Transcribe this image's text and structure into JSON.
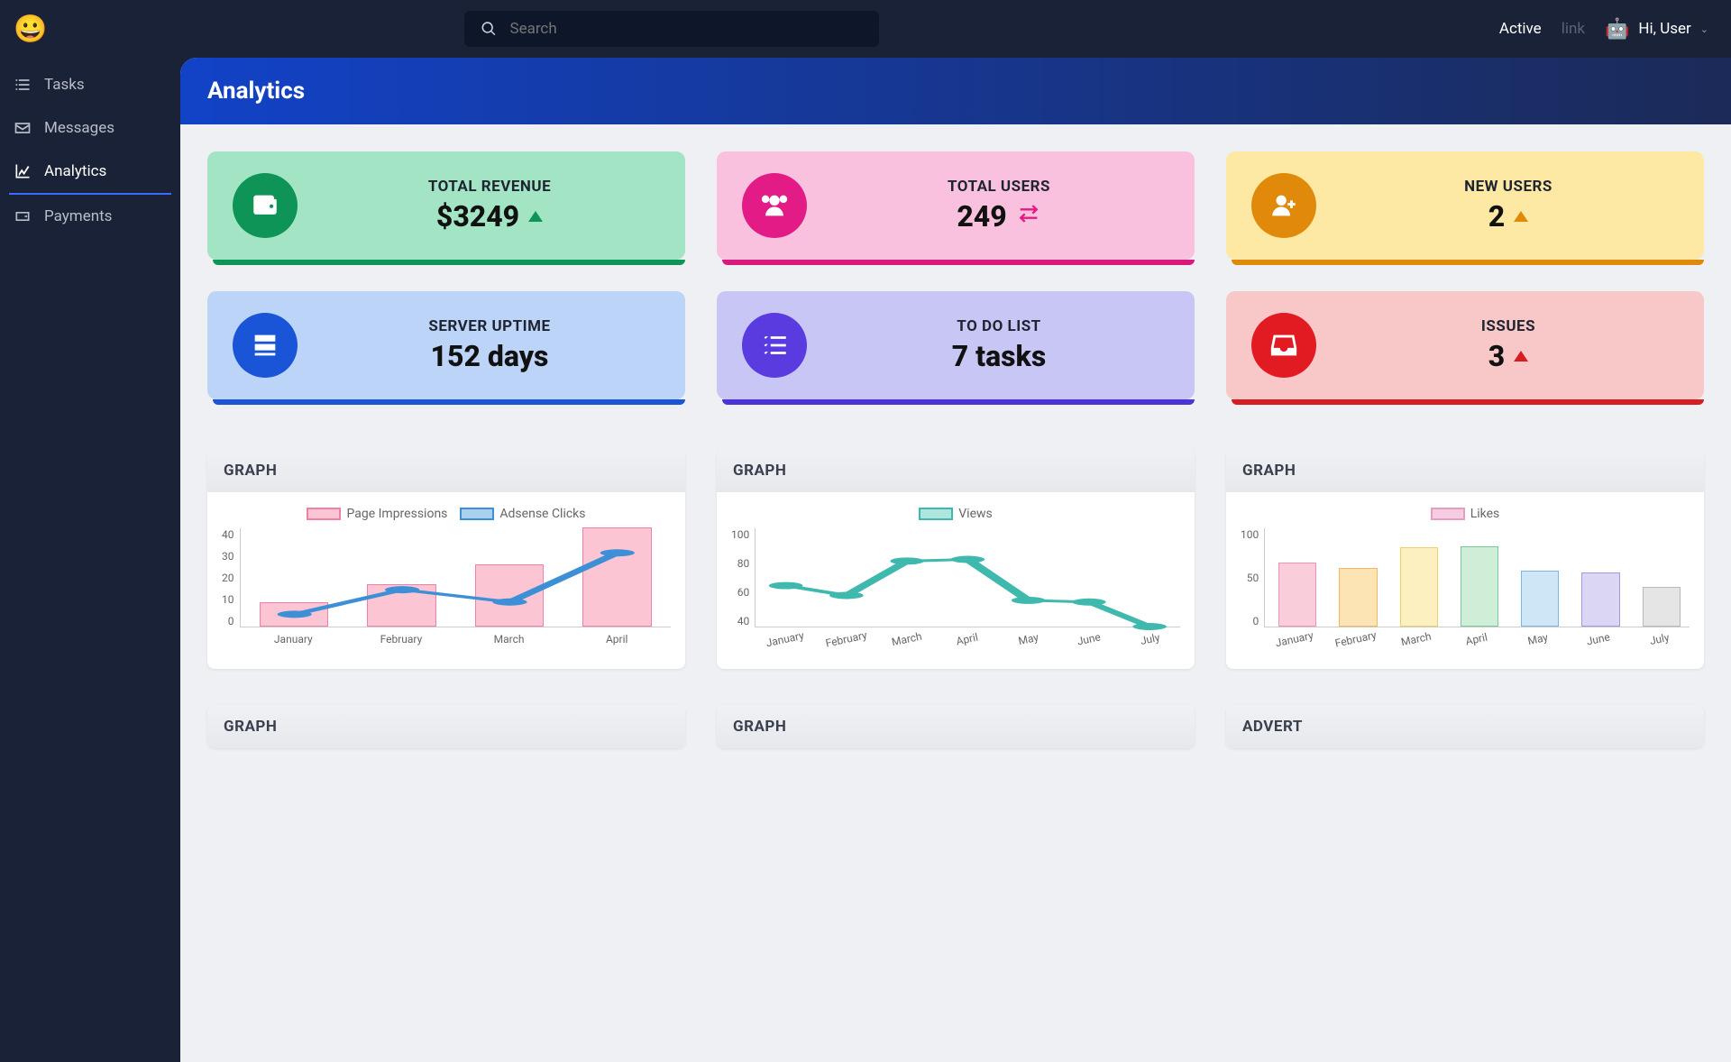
{
  "sidebar": {
    "items": [
      {
        "label": "Tasks",
        "icon": "tasks"
      },
      {
        "label": "Messages",
        "icon": "envelope"
      },
      {
        "label": "Analytics",
        "icon": "chart",
        "active": true
      },
      {
        "label": "Payments",
        "icon": "wallet"
      }
    ]
  },
  "topbar": {
    "search_placeholder": "Search",
    "active_label": "Active",
    "link_label": "link",
    "user_greeting": "Hi, User"
  },
  "page": {
    "title": "Analytics"
  },
  "stats": [
    {
      "label": "TOTAL REVENUE",
      "value": "$3249",
      "trend": "up-green",
      "icon": "wallet",
      "scheme": "green"
    },
    {
      "label": "TOTAL USERS",
      "value": "249",
      "trend": "swap",
      "icon": "users",
      "scheme": "pink"
    },
    {
      "label": "NEW USERS",
      "value": "2",
      "trend": "up-orange",
      "icon": "user-plus",
      "scheme": "yellow"
    },
    {
      "label": "SERVER UPTIME",
      "value": "152 days",
      "trend": "",
      "icon": "server",
      "scheme": "blue"
    },
    {
      "label": "TO DO LIST",
      "value": "7 tasks",
      "trend": "",
      "icon": "list",
      "scheme": "purple"
    },
    {
      "label": "ISSUES",
      "value": "3",
      "trend": "up-red",
      "icon": "inbox",
      "scheme": "red"
    }
  ],
  "graph_titles": {
    "g": "GRAPH",
    "a": "ADVERT"
  },
  "chart_data": [
    {
      "type": "bar+line",
      "title": "GRAPH",
      "categories": [
        "January",
        "February",
        "March",
        "April"
      ],
      "series": [
        {
          "name": "Page Impressions",
          "type": "bar",
          "color": "#fbc5d3",
          "values": [
            10,
            17,
            25,
            40
          ]
        },
        {
          "name": "Adsense Clicks",
          "type": "line",
          "color": "#3d8fd6",
          "values": [
            5,
            15,
            10,
            30
          ]
        }
      ],
      "ylim": [
        0,
        40
      ],
      "yticks": [
        0,
        10,
        20,
        30,
        40
      ]
    },
    {
      "type": "line",
      "title": "GRAPH",
      "categories": [
        "January",
        "February",
        "March",
        "April",
        "May",
        "June",
        "July"
      ],
      "series": [
        {
          "name": "Views",
          "type": "line",
          "color": "#3fb9ad",
          "values": [
            65,
            59,
            80,
            81,
            56,
            55,
            40
          ]
        }
      ],
      "ylim": [
        40,
        100
      ],
      "yticks": [
        40,
        60,
        80,
        100
      ]
    },
    {
      "type": "bar",
      "title": "GRAPH",
      "categories": [
        "January",
        "February",
        "March",
        "April",
        "May",
        "June",
        "July"
      ],
      "series": [
        {
          "name": "Likes",
          "type": "bar",
          "values": [
            65,
            59,
            80,
            81,
            56,
            55,
            40
          ]
        }
      ],
      "ylim": [
        0,
        100
      ],
      "yticks": [
        0,
        50,
        100
      ]
    }
  ]
}
